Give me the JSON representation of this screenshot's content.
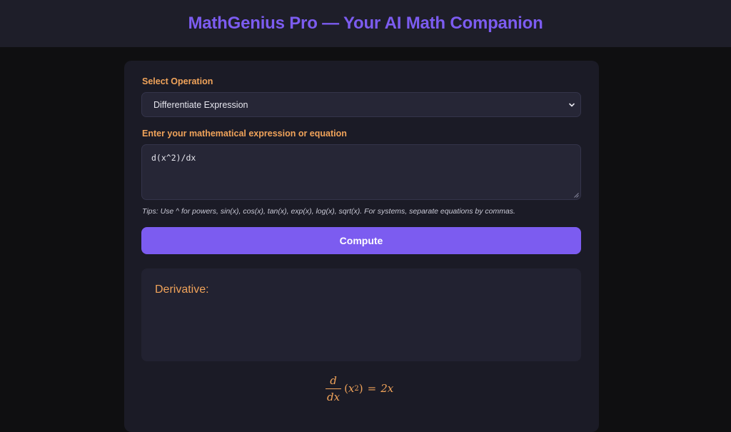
{
  "header": {
    "title": "MathGenius Pro — Your AI Math Companion"
  },
  "form": {
    "operation_label": "Select Operation",
    "operation_selected": "Differentiate Expression",
    "expression_label": "Enter your mathematical expression or equation",
    "expression_value": "d(x^2)/dx",
    "tips": "Tips: Use ^ for powers, sin(x), cos(x), tan(x), exp(x), log(x), sqrt(x). For systems, separate equations by commas.",
    "compute_label": "Compute"
  },
  "result": {
    "title": "Derivative:",
    "math": {
      "numerator": "d",
      "denominator": "dx",
      "open_paren": "(",
      "base": "x",
      "exponent": "2",
      "close_paren": ")",
      "equals": "=",
      "rhs": "2x"
    }
  },
  "colors": {
    "accent": "#7c5cf0",
    "label": "#f0a35a",
    "header_bg": "#1e1e29",
    "page_bg": "#0f0f11",
    "card_bg": "#1b1b26"
  },
  "icons": {
    "select_chevron": "chevron-down-icon",
    "resize_grip": "resize-handle-icon"
  }
}
